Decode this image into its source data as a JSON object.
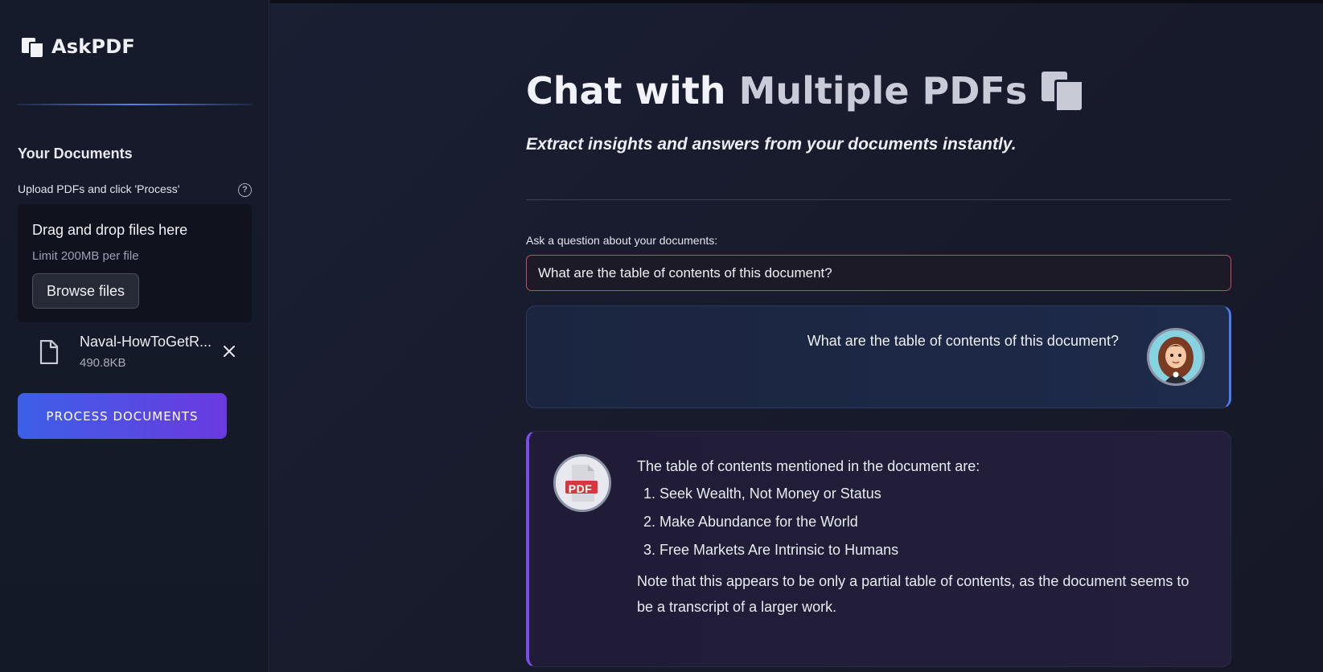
{
  "sidebar": {
    "brand": "AskPDF",
    "section_title": "Your Documents",
    "upload_label": "Upload PDFs and click 'Process'",
    "help_glyph": "?",
    "dropzone": {
      "title": "Drag and drop files here",
      "limit": "Limit 200MB per file",
      "browse_label": "Browse files"
    },
    "file": {
      "name": "Naval-HowToGetR...",
      "size": "490.8KB"
    },
    "process_label": "PROCESS DOCUMENTS"
  },
  "main": {
    "title_prefix": "Chat with",
    "title_highlight": "Multiple PDFs",
    "subtitle": "Extract insights and answers from your documents instantly.",
    "question_label": "Ask a question about your documents:",
    "question_value": "What are the table of contents of this document?",
    "user_message": "What are the table of contents of this document?",
    "bot_avatar_label": "PDF",
    "bot_message": {
      "intro": "The table of contents mentioned in the document are:",
      "items": [
        "Seek Wealth, Not Money or Status",
        "Make Abundance for the World",
        "Free Markets Are Intrinsic to Humans"
      ],
      "note": "Note that this appears to be only a partial table of contents, as the document seems to be a transcript of a larger work."
    }
  },
  "colors": {
    "accent_blue": "#4e7cf0",
    "accent_purple": "#7a4ce8",
    "input_border": "#c84b5e"
  }
}
